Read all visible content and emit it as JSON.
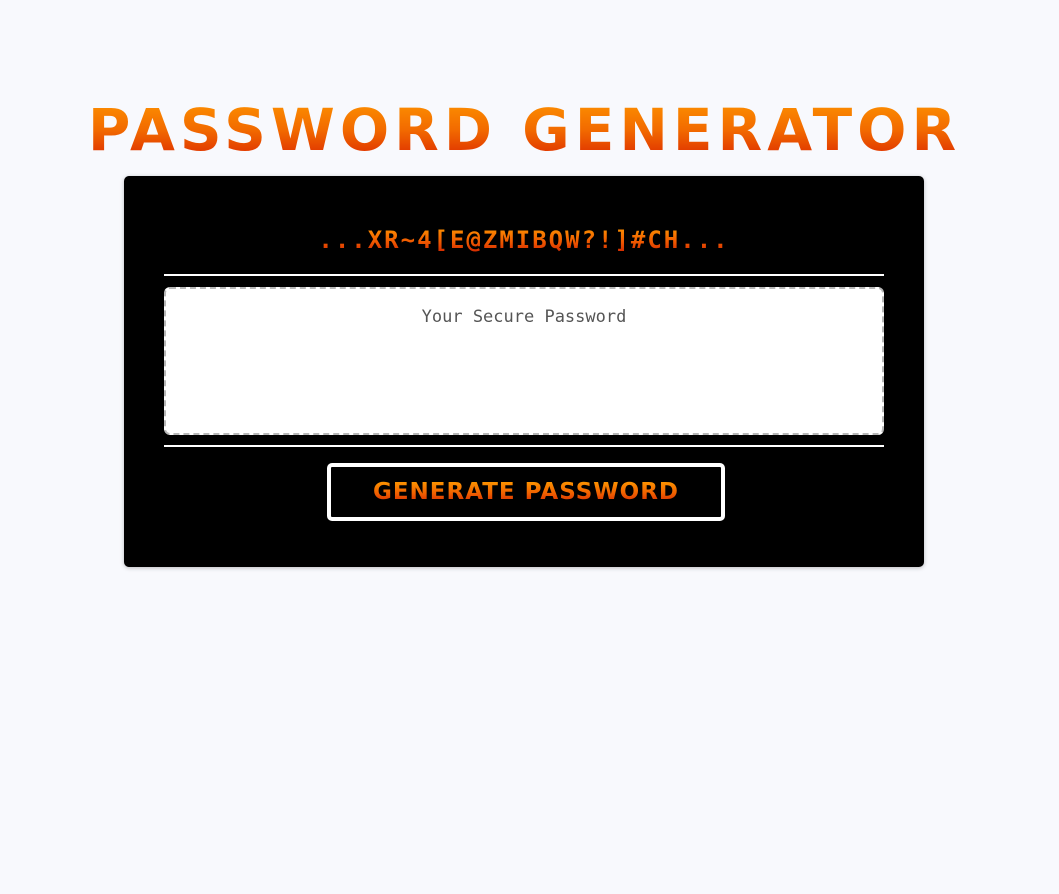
{
  "header": {
    "title": "Password Generator"
  },
  "card": {
    "scramble_text": "...XR~4[E@ZMIBQW?!]#CH...",
    "password": {
      "value": "",
      "placeholder": "Your Secure Password"
    },
    "generate_button_label": "Generate Password"
  },
  "colors": {
    "page_background": "#f8f9fd",
    "card_background": "#000000",
    "gradient_top": "#ff9800",
    "gradient_bottom": "#d81e00",
    "divider": "#ffffff",
    "button_border": "#ffffff"
  }
}
